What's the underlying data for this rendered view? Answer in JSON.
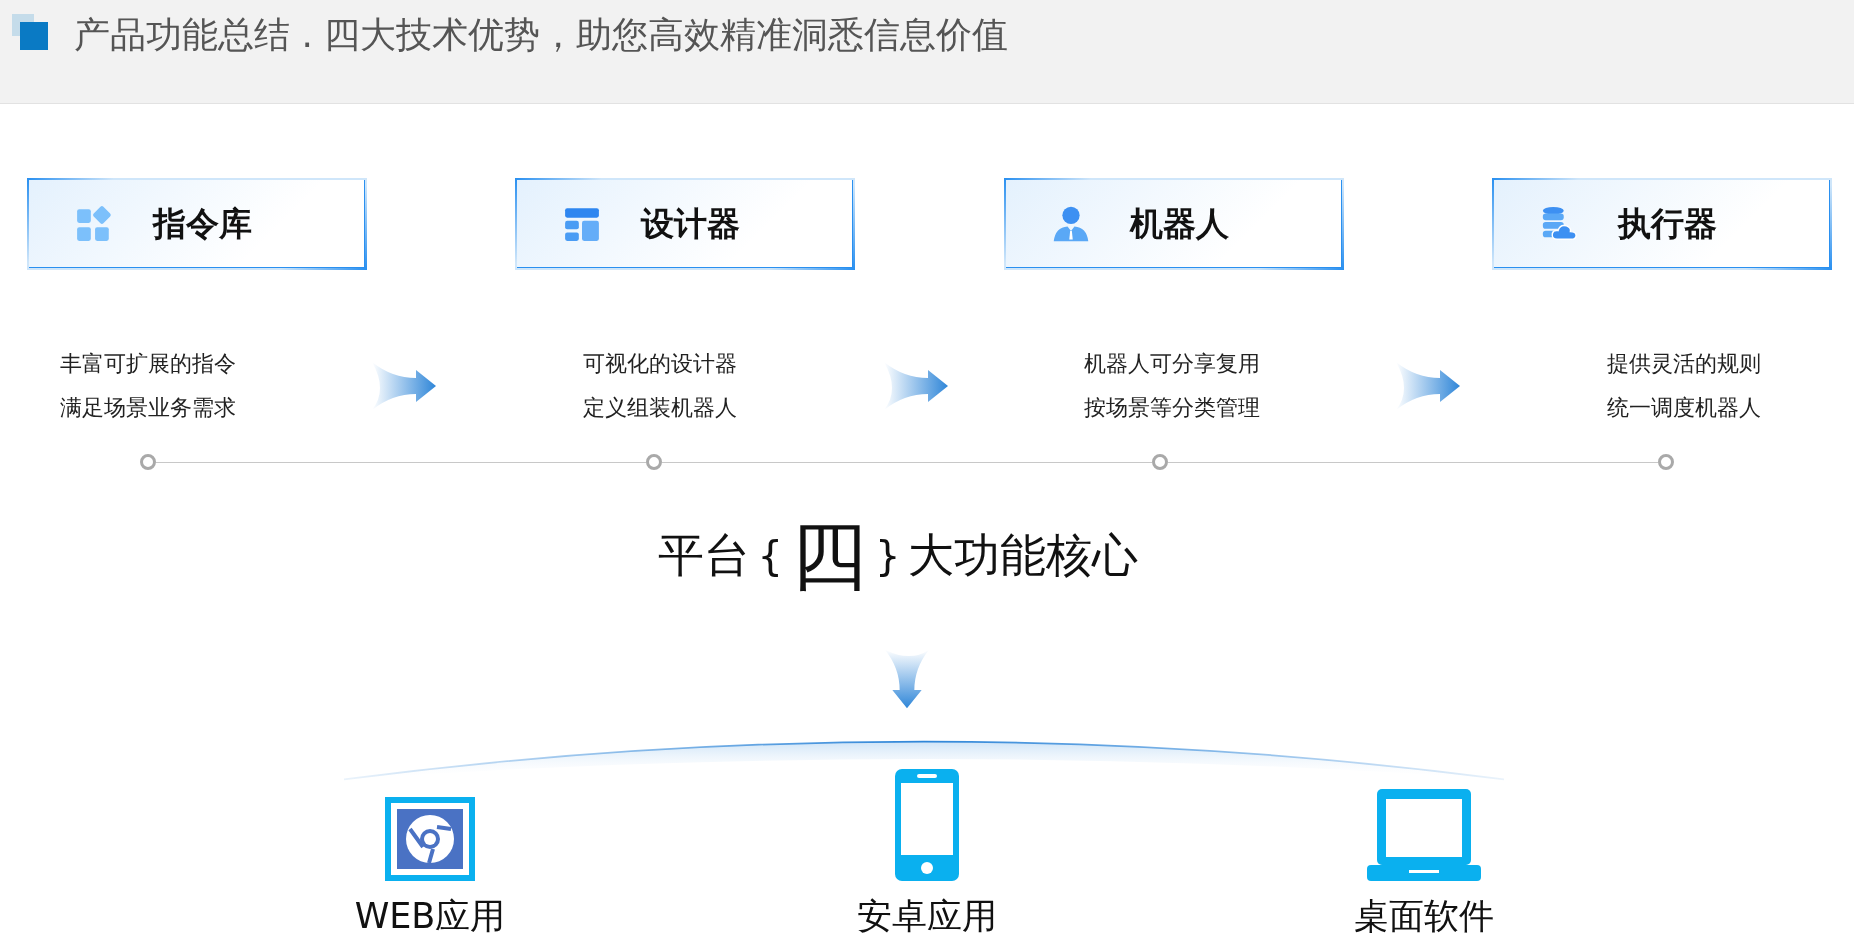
{
  "header": {
    "title": "产品功能总结 . 四大技术优势，助您高效精准洞悉信息价值"
  },
  "features": [
    {
      "title": "指令库",
      "kind": "grid",
      "lines": [
        "丰富可扩展的指令",
        "满足场景业务需求"
      ]
    },
    {
      "title": "设计器",
      "kind": "layout",
      "lines": [
        "可视化的设计器",
        "定义组装机器人"
      ]
    },
    {
      "title": "机器人",
      "kind": "user",
      "lines": [
        "机器人可分享复用",
        "按场景等分类管理"
      ]
    },
    {
      "title": "执行器",
      "kind": "database",
      "lines": [
        "提供灵活的规则",
        "统一调度机器人"
      ]
    }
  ],
  "core": {
    "prefix": "平台",
    "open": "{",
    "highlight": "四",
    "close": "}",
    "suffix": "大功能核心"
  },
  "platforms": [
    {
      "label": "WEB应用",
      "kind": "browser"
    },
    {
      "label": "安卓应用",
      "kind": "phone"
    },
    {
      "label": "桌面软件",
      "kind": "laptop"
    }
  ]
}
